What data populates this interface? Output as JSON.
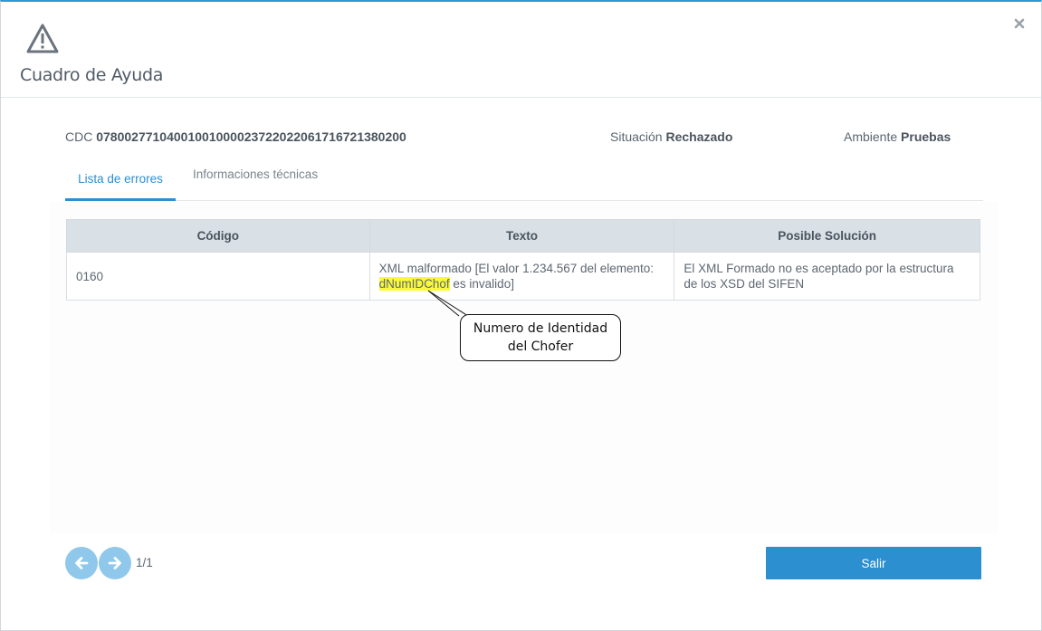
{
  "modal": {
    "title": "Cuadro de Ayuda",
    "icon": "warning-triangle-icon",
    "close_icon": "close-icon"
  },
  "info": {
    "cdc_label": "CDC",
    "cdc_value": "07800277104001001000023722022061716721380200",
    "situacion_label": "Situación",
    "situacion_value": "Rechazado",
    "ambiente_label": "Ambiente",
    "ambiente_value": "Pruebas"
  },
  "tabs": [
    {
      "label": "Lista de errores",
      "active": true
    },
    {
      "label": "Informaciones técnicas",
      "active": false
    }
  ],
  "table": {
    "headers": [
      "Código",
      "Texto",
      "Posible Solución"
    ],
    "rows": [
      {
        "codigo": "0160",
        "texto_prefix": "XML malformado [El valor 1.234.567 del elemento:",
        "texto_highlight": "dNumIDChof",
        "texto_suffix": " es invalido]",
        "solucion": "El XML Formado no es aceptado por la estructura de los XSD del SIFEN"
      }
    ]
  },
  "callout": {
    "line1": "Numero de Identidad",
    "line2": "del Chofer"
  },
  "pagination": {
    "prev_icon": "arrow-left-icon",
    "next_icon": "arrow-right-icon",
    "indicator": "1/1"
  },
  "footer": {
    "exit_label": "Salir"
  },
  "colors": {
    "accent": "#2b8fd0",
    "header_bg": "#d9e1e7",
    "highlight": "#f9f93a",
    "nav_button": "#8fc8ea"
  }
}
